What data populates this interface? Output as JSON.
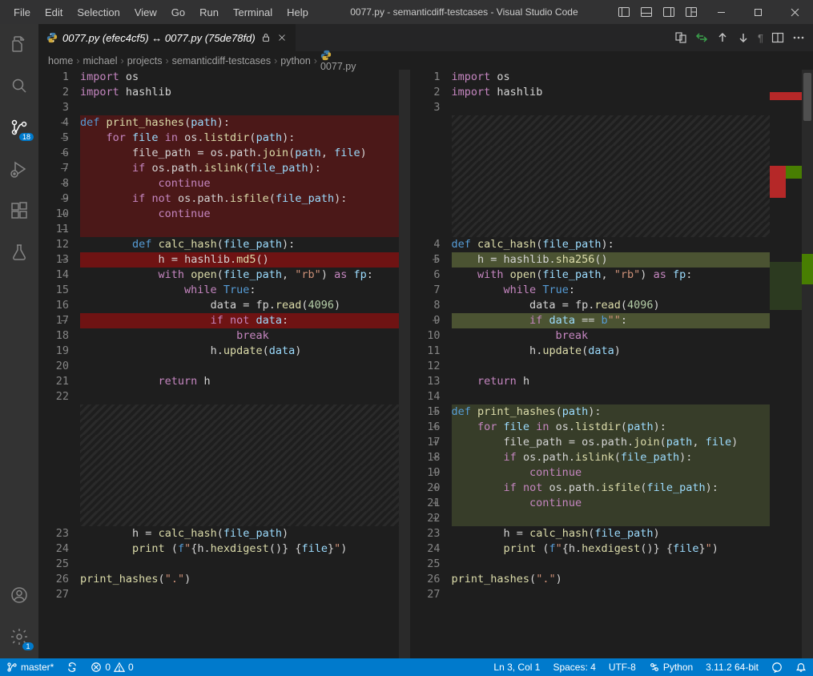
{
  "menu": [
    "File",
    "Edit",
    "Selection",
    "View",
    "Go",
    "Run",
    "Terminal",
    "Help"
  ],
  "window_title": "0077.py - semanticdiff-testcases - Visual Studio Code",
  "tab": {
    "label": "0077.py (efec4cf5) ↔ 0077.py (75de78fd)"
  },
  "breadcrumbs": [
    "home",
    "michael",
    "projects",
    "semanticdiff-testcases",
    "python",
    "0077.py"
  ],
  "activity_badges": {
    "scm": "18",
    "settings": "1"
  },
  "status": {
    "branch": "master*",
    "errors": "0",
    "warnings": "0",
    "cursor": "Ln 3, Col 1",
    "spaces": "Spaces: 4",
    "encoding": "UTF-8",
    "lang": "Python",
    "pyver": "3.11.2 64-bit"
  },
  "left_lines": [
    {
      "n": "1",
      "cls": "",
      "html": "<span class='kw2'>import</span> <span class='plain'>os</span>"
    },
    {
      "n": "2",
      "cls": "",
      "html": "<span class='kw2'>import</span> <span class='plain'>hashlib</span>"
    },
    {
      "n": "3",
      "cls": "",
      "html": ""
    },
    {
      "n": "4",
      "cls": "bg-del",
      "mark": "–",
      "html": "<span class='kw'>def</span> <span class='fn'>print_hashes</span><span class='pun'>(</span><span class='var'>path</span><span class='pun'>):</span>"
    },
    {
      "n": "5",
      "cls": "bg-del",
      "mark": "–",
      "html": "    <span class='kw2'>for</span> <span class='var'>file</span> <span class='kw2'>in</span> <span class='plain'>os</span><span class='pun'>.</span><span class='fn'>listdir</span><span class='pun'>(</span><span class='var'>path</span><span class='pun'>):</span>"
    },
    {
      "n": "6",
      "cls": "bg-del",
      "mark": "–",
      "html": "        <span class='plain'>file_path </span><span class='pun'>=</span><span class='plain'> os</span><span class='pun'>.</span><span class='plain'>path</span><span class='pun'>.</span><span class='fn'>join</span><span class='pun'>(</span><span class='var'>path</span><span class='pun'>,</span> <span class='var'>file</span><span class='pun'>)</span>"
    },
    {
      "n": "7",
      "cls": "bg-del",
      "mark": "–",
      "html": "        <span class='kw2'>if</span> <span class='plain'>os</span><span class='pun'>.</span><span class='plain'>path</span><span class='pun'>.</span><span class='fn'>islink</span><span class='pun'>(</span><span class='var'>file_path</span><span class='pun'>):</span>"
    },
    {
      "n": "8",
      "cls": "bg-del",
      "mark": "–",
      "html": "            <span class='kw2'>continue</span>"
    },
    {
      "n": "9",
      "cls": "bg-del",
      "mark": "–",
      "html": "        <span class='kw2'>if</span> <span class='kw2'>not</span> <span class='plain'>os</span><span class='pun'>.</span><span class='plain'>path</span><span class='pun'>.</span><span class='fn'>isfile</span><span class='pun'>(</span><span class='var'>file_path</span><span class='pun'>):</span>"
    },
    {
      "n": "10",
      "cls": "bg-del",
      "mark": "–",
      "html": "            <span class='kw2'>continue</span>"
    },
    {
      "n": "11",
      "cls": "bg-del",
      "mark": "–",
      "html": ""
    },
    {
      "n": "12",
      "cls": "",
      "html": "        <span class='kw'>def</span> <span class='fn'>calc_hash</span><span class='pun'>(</span><span class='var'>file_path</span><span class='pun'>):</span>"
    },
    {
      "n": "13",
      "cls": "bg-del-s",
      "mark": "–",
      "html": "            <span class='plain'>h </span><span class='pun'>=</span><span class='plain'> hashlib</span><span class='pun'>.</span><span class='fn'>md5</span><span class='pun'>()</span>"
    },
    {
      "n": "14",
      "cls": "",
      "html": "            <span class='kw2'>with</span> <span class='fn'>open</span><span class='pun'>(</span><span class='var'>file_path</span><span class='pun'>,</span> <span class='str'>\"rb\"</span><span class='pun'>)</span> <span class='kw2'>as</span> <span class='var'>fp</span><span class='pun'>:</span>"
    },
    {
      "n": "15",
      "cls": "",
      "html": "                <span class='kw2'>while</span> <span class='const'>True</span><span class='pun'>:</span>"
    },
    {
      "n": "16",
      "cls": "",
      "html": "                    <span class='plain'>data </span><span class='pun'>=</span><span class='plain'> fp</span><span class='pun'>.</span><span class='fn'>read</span><span class='pun'>(</span><span class='num'>4096</span><span class='pun'>)</span>"
    },
    {
      "n": "17",
      "cls": "bg-del-s",
      "mark": "–",
      "html": "                    <span class='kw2'>if</span> <span class='kw2'>not</span> <span class='var'>data</span><span class='pun'>:</span>"
    },
    {
      "n": "18",
      "cls": "",
      "html": "                        <span class='kw2'>break</span>"
    },
    {
      "n": "19",
      "cls": "",
      "html": "                    <span class='plain'>h</span><span class='pun'>.</span><span class='fn'>update</span><span class='pun'>(</span><span class='var'>data</span><span class='pun'>)</span>"
    },
    {
      "n": "20",
      "cls": "",
      "html": ""
    },
    {
      "n": "21",
      "cls": "",
      "html": "            <span class='kw2'>return</span> <span class='plain'>h</span>"
    },
    {
      "n": "22",
      "cls": "",
      "html": ""
    },
    {
      "n": "",
      "cls": "bg-hatch",
      "html": ""
    },
    {
      "n": "",
      "cls": "bg-hatch",
      "html": ""
    },
    {
      "n": "",
      "cls": "bg-hatch",
      "html": ""
    },
    {
      "n": "",
      "cls": "bg-hatch",
      "html": ""
    },
    {
      "n": "",
      "cls": "bg-hatch",
      "html": ""
    },
    {
      "n": "",
      "cls": "bg-hatch",
      "html": ""
    },
    {
      "n": "",
      "cls": "bg-hatch",
      "html": ""
    },
    {
      "n": "",
      "cls": "bg-hatch",
      "html": ""
    },
    {
      "n": "23",
      "cls": "",
      "html": "        <span class='plain'>h </span><span class='pun'>=</span> <span class='fn'>calc_hash</span><span class='pun'>(</span><span class='var'>file_path</span><span class='pun'>)</span>"
    },
    {
      "n": "24",
      "cls": "",
      "html": "        <span class='fn'>print</span> <span class='pun'>(</span><span class='kw'>f</span><span class='str'>\"</span><span class='pun'>{</span><span class='plain'>h</span><span class='pun'>.</span><span class='fn'>hexdigest</span><span class='pun'>()}</span> <span class='pun'>{</span><span class='var'>file</span><span class='pun'>}</span><span class='str'>\"</span><span class='pun'>)</span>"
    },
    {
      "n": "25",
      "cls": "",
      "html": ""
    },
    {
      "n": "26",
      "cls": "",
      "html": "<span class='fn'>print_hashes</span><span class='pun'>(</span><span class='str'>\".\"</span><span class='pun'>)</span>"
    },
    {
      "n": "27",
      "cls": "",
      "html": ""
    }
  ],
  "right_lines": [
    {
      "n": "1",
      "cls": "",
      "html": "<span class='kw2'>import</span> <span class='plain'>os</span>"
    },
    {
      "n": "2",
      "cls": "",
      "html": "<span class='kw2'>import</span> <span class='plain'>hashlib</span>"
    },
    {
      "n": "3",
      "cls": "",
      "html": ""
    },
    {
      "n": "",
      "cls": "bg-hatch",
      "html": ""
    },
    {
      "n": "",
      "cls": "bg-hatch",
      "html": ""
    },
    {
      "n": "",
      "cls": "bg-hatch",
      "html": ""
    },
    {
      "n": "",
      "cls": "bg-hatch",
      "html": ""
    },
    {
      "n": "",
      "cls": "bg-hatch",
      "html": ""
    },
    {
      "n": "",
      "cls": "bg-hatch",
      "html": ""
    },
    {
      "n": "",
      "cls": "bg-hatch",
      "html": ""
    },
    {
      "n": "",
      "cls": "bg-hatch",
      "html": ""
    },
    {
      "n": "4",
      "cls": "",
      "html": "<span class='kw'>def</span> <span class='fn'>calc_hash</span><span class='pun'>(</span><span class='var'>file_path</span><span class='pun'>):</span>"
    },
    {
      "n": "5",
      "cls": "bg-add-s",
      "mark": "+",
      "html": "    <span class='plain'>h </span><span class='pun'>=</span><span class='plain'> hashlib</span><span class='pun'>.</span><span class='fn'>sha256</span><span class='pun'>()</span>"
    },
    {
      "n": "6",
      "cls": "",
      "html": "    <span class='kw2'>with</span> <span class='fn'>open</span><span class='pun'>(</span><span class='var'>file_path</span><span class='pun'>,</span> <span class='str'>\"rb\"</span><span class='pun'>)</span> <span class='kw2'>as</span> <span class='var'>fp</span><span class='pun'>:</span>"
    },
    {
      "n": "7",
      "cls": "",
      "html": "        <span class='kw2'>while</span> <span class='const'>True</span><span class='pun'>:</span>"
    },
    {
      "n": "8",
      "cls": "",
      "html": "            <span class='plain'>data </span><span class='pun'>=</span><span class='plain'> fp</span><span class='pun'>.</span><span class='fn'>read</span><span class='pun'>(</span><span class='num'>4096</span><span class='pun'>)</span>"
    },
    {
      "n": "9",
      "cls": "bg-add-s",
      "mark": "+",
      "html": "            <span class='kw2'>if</span> <span class='var'>data</span> <span class='pun'>==</span> <span class='kw'>b</span><span class='str'>\"\"</span><span class='pun'>:</span>"
    },
    {
      "n": "10",
      "cls": "",
      "html": "                <span class='kw2'>break</span>"
    },
    {
      "n": "11",
      "cls": "",
      "html": "            <span class='plain'>h</span><span class='pun'>.</span><span class='fn'>update</span><span class='pun'>(</span><span class='var'>data</span><span class='pun'>)</span>"
    },
    {
      "n": "12",
      "cls": "",
      "html": ""
    },
    {
      "n": "13",
      "cls": "",
      "html": "    <span class='kw2'>return</span> <span class='plain'>h</span>"
    },
    {
      "n": "14",
      "cls": "",
      "html": ""
    },
    {
      "n": "15",
      "cls": "bg-add",
      "mark": "+",
      "html": "<span class='kw'>def</span> <span class='fn'>print_hashes</span><span class='pun'>(</span><span class='var'>path</span><span class='pun'>):</span>"
    },
    {
      "n": "16",
      "cls": "bg-add",
      "mark": "+",
      "html": "    <span class='kw2'>for</span> <span class='var'>file</span> <span class='kw2'>in</span> <span class='plain'>os</span><span class='pun'>.</span><span class='fn'>listdir</span><span class='pun'>(</span><span class='var'>path</span><span class='pun'>):</span>"
    },
    {
      "n": "17",
      "cls": "bg-add",
      "mark": "+",
      "html": "        <span class='plain'>file_path </span><span class='pun'>=</span><span class='plain'> os</span><span class='pun'>.</span><span class='plain'>path</span><span class='pun'>.</span><span class='fn'>join</span><span class='pun'>(</span><span class='var'>path</span><span class='pun'>,</span> <span class='var'>file</span><span class='pun'>)</span>"
    },
    {
      "n": "18",
      "cls": "bg-add",
      "mark": "+",
      "html": "        <span class='kw2'>if</span> <span class='plain'>os</span><span class='pun'>.</span><span class='plain'>path</span><span class='pun'>.</span><span class='fn'>islink</span><span class='pun'>(</span><span class='var'>file_path</span><span class='pun'>):</span>"
    },
    {
      "n": "19",
      "cls": "bg-add",
      "mark": "+",
      "html": "            <span class='kw2'>continue</span>"
    },
    {
      "n": "20",
      "cls": "bg-add",
      "mark": "+",
      "html": "        <span class='kw2'>if</span> <span class='kw2'>not</span> <span class='plain'>os</span><span class='pun'>.</span><span class='plain'>path</span><span class='pun'>.</span><span class='fn'>isfile</span><span class='pun'>(</span><span class='var'>file_path</span><span class='pun'>):</span>"
    },
    {
      "n": "21",
      "cls": "bg-add",
      "mark": "+",
      "html": "            <span class='kw2'>continue</span>"
    },
    {
      "n": "22",
      "cls": "bg-add",
      "mark": "+",
      "html": ""
    },
    {
      "n": "23",
      "cls": "",
      "html": "        <span class='plain'>h </span><span class='pun'>=</span> <span class='fn'>calc_hash</span><span class='pun'>(</span><span class='var'>file_path</span><span class='pun'>)</span>"
    },
    {
      "n": "24",
      "cls": "",
      "html": "        <span class='fn'>print</span> <span class='pun'>(</span><span class='kw'>f</span><span class='str'>\"</span><span class='pun'>{</span><span class='plain'>h</span><span class='pun'>.</span><span class='fn'>hexdigest</span><span class='pun'>()}</span> <span class='pun'>{</span><span class='var'>file</span><span class='pun'>}</span><span class='str'>\"</span><span class='pun'>)</span>"
    },
    {
      "n": "25",
      "cls": "",
      "html": ""
    },
    {
      "n": "26",
      "cls": "",
      "html": "<span class='fn'>print_hashes</span><span class='pun'>(</span><span class='str'>\".\"</span><span class='pun'>)</span>"
    },
    {
      "n": "27",
      "cls": "",
      "html": ""
    }
  ]
}
